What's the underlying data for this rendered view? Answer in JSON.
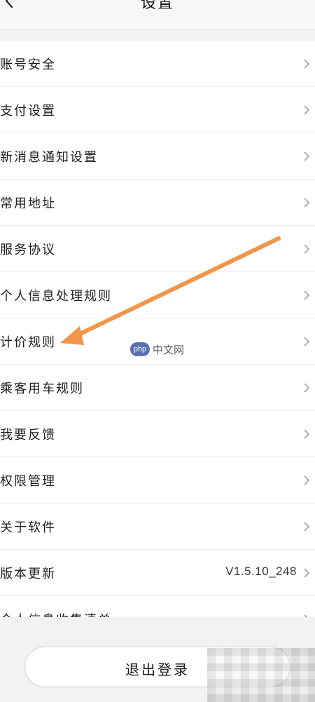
{
  "header": {
    "title": "设置",
    "back_icon": "chevron-left-icon"
  },
  "settings": {
    "items": [
      {
        "label": "账号安全"
      },
      {
        "label": "支付设置"
      },
      {
        "label": "新消息通知设置"
      },
      {
        "label": "常用地址"
      },
      {
        "label": "服务协议"
      },
      {
        "label": "个人信息处理规则"
      },
      {
        "label": "计价规则"
      },
      {
        "label": "乘客用车规则"
      },
      {
        "label": "我要反馈"
      },
      {
        "label": "权限管理"
      },
      {
        "label": "关于软件"
      },
      {
        "label": "版本更新",
        "value": "V1.5.10_248"
      },
      {
        "label": "个人信息收集清单"
      }
    ],
    "chevron_icon": "chevron-right-icon"
  },
  "watermark": {
    "logo": "php",
    "text": "中文网"
  },
  "annotation": {
    "type": "arrow",
    "color": "#f0954a"
  },
  "footer": {
    "logout_label": "退出登录"
  }
}
